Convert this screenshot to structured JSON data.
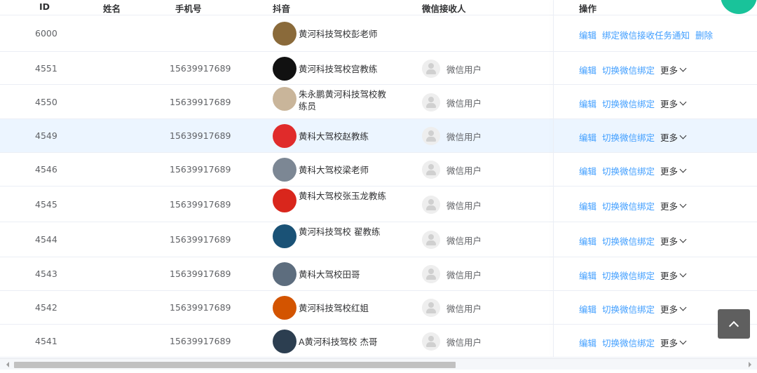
{
  "header": {
    "id": "ID",
    "name": "姓名",
    "phone": "手机号",
    "douyin": "抖音",
    "wechat": "微信接收人",
    "ops": "操作"
  },
  "rows": [
    {
      "id": "6000",
      "phone": "",
      "douyin": "黄河科技驾校彭老师",
      "wechat": "",
      "op1": "编辑",
      "op2": "绑定微信接收任务通知",
      "op3": "删除",
      "avatar_color": "#8a6a3a"
    },
    {
      "id": "4551",
      "phone": "15639917689",
      "douyin": "黄河科技驾校宫教练",
      "wechat": "微信用户",
      "op1": "编辑",
      "op2": "切换微信绑定",
      "op3": "更多",
      "avatar_color": "#111111"
    },
    {
      "id": "4550",
      "phone": "15639917689",
      "douyin": "朱永鹏黄河科技驾校教练员",
      "wechat": "微信用户",
      "op1": "编辑",
      "op2": "切换微信绑定",
      "op3": "更多",
      "avatar_color": "#c9b59a"
    },
    {
      "id": "4549",
      "phone": "15639917689",
      "douyin": "黄科大驾校赵教练",
      "wechat": "微信用户",
      "op1": "编辑",
      "op2": "切换微信绑定",
      "op3": "更多",
      "avatar_color": "#e02b2b"
    },
    {
      "id": "4546",
      "phone": "15639917689",
      "douyin": "黄科大驾校梁老师",
      "wechat": "微信用户",
      "op1": "编辑",
      "op2": "切换微信绑定",
      "op3": "更多",
      "avatar_color": "#7c8794"
    },
    {
      "id": "4545",
      "phone": "15639917689",
      "douyin": "黄科大驾校张玉龙教练",
      "wechat": "微信用户",
      "op1": "编辑",
      "op2": "切换微信绑定",
      "op3": "更多",
      "avatar_color": "#d9261c"
    },
    {
      "id": "4544",
      "phone": "15639917689",
      "douyin": "黄河科技驾校 翟教练",
      "wechat": "微信用户",
      "op1": "编辑",
      "op2": "切换微信绑定",
      "op3": "更多",
      "avatar_color": "#1a5276"
    },
    {
      "id": "4543",
      "phone": "15639917689",
      "douyin": "黄科大驾校田哥",
      "wechat": "微信用户",
      "op1": "编辑",
      "op2": "切换微信绑定",
      "op3": "更多",
      "avatar_color": "#5d6d7e"
    },
    {
      "id": "4542",
      "phone": "15639917689",
      "douyin": "黄河科技驾校红姐",
      "wechat": "微信用户",
      "op1": "编辑",
      "op2": "切换微信绑定",
      "op3": "更多",
      "avatar_color": "#d35400"
    },
    {
      "id": "4541",
      "phone": "15639917689",
      "douyin": "A黄河科技驾校 杰哥",
      "wechat": "微信用户",
      "op1": "编辑",
      "op2": "切换微信绑定",
      "op3": "更多",
      "avatar_color": "#2c3e50"
    }
  ],
  "colors": {
    "link": "#409eff",
    "hover_row": "#ecf5ff",
    "border": "#ebeef5",
    "accent_green": "#19c39a"
  }
}
